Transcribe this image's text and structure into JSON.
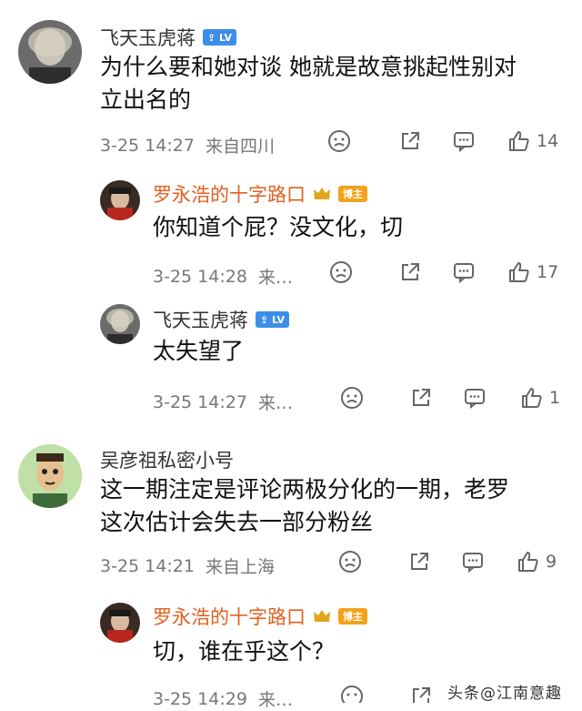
{
  "comments": [
    {
      "name": "飞天玉虎蒋",
      "badge": "",
      "text_line1": "为什么要和她对谈  她就是故意挑起性别对",
      "text_line2": "立出名的",
      "time": "3-25 14:27",
      "location": "来自四川",
      "likes": "14"
    },
    {
      "name": "罗永浩的十字路口",
      "badge": "博主",
      "text_line1": "你知道个屁？没文化，切",
      "time": "3-25 14:28",
      "location": "来…",
      "likes": "17"
    },
    {
      "name": "飞天玉虎蒋",
      "badge": "",
      "text_line1": "太失望了",
      "time": "3-25 14:27",
      "location": "来…",
      "likes": "1"
    },
    {
      "name": "吴彦祖私密小号",
      "text_line1": "这一期注定是评论两极分化的一期，老罗",
      "text_line2": "这次估计会失去一部分粉丝",
      "time": "3-25 14:21",
      "location": "来自上海",
      "likes": "9"
    },
    {
      "name": "罗永浩的十字路口",
      "badge": "博主",
      "text_line1": "切，谁在乎这个？",
      "time": "3-25 14:29",
      "location": "来…",
      "likes": ""
    }
  ],
  "watermark": "头条@江南意趣",
  "colors": {
    "blogger_name": "#e2601f",
    "badge_blue": "#3d8ee8",
    "badge_gold": "#f2a21a"
  }
}
